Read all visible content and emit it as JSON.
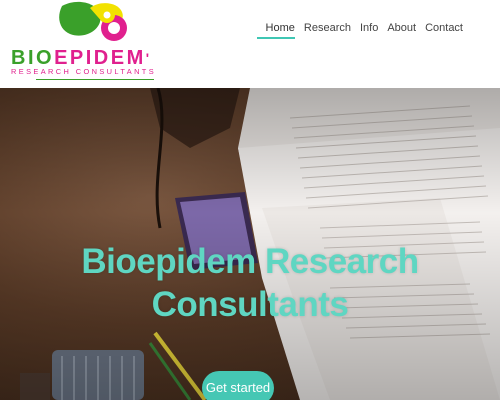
{
  "brand": {
    "name_part1": "BIO",
    "name_part2": "EPIDEM",
    "apostrophe": "'",
    "tagline": "RESEARCH CONSULTANTS"
  },
  "nav": {
    "items": [
      {
        "label": "Home",
        "active": true
      },
      {
        "label": "Research",
        "active": false
      },
      {
        "label": "Info",
        "active": false
      },
      {
        "label": "About",
        "active": false
      },
      {
        "label": "Contact",
        "active": false
      }
    ]
  },
  "hero": {
    "title_line1": "Bioepidem Research",
    "title_line2": "Consultants",
    "cta_label": "Get started"
  },
  "colors": {
    "accent": "#45c7b4",
    "brand_green": "#3aa02a",
    "brand_pink": "#e0208e",
    "brand_yellow": "#f2e200"
  }
}
